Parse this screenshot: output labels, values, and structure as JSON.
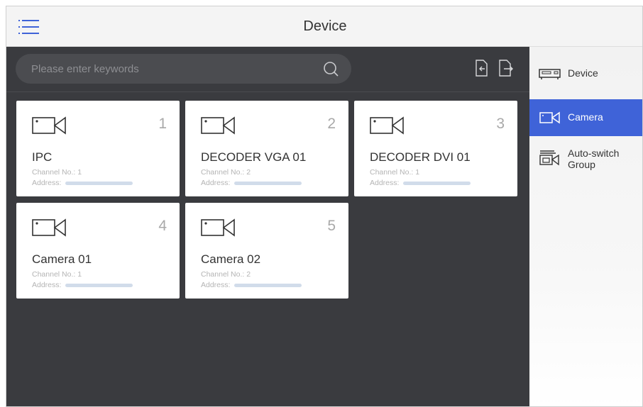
{
  "header": {
    "title": "Device"
  },
  "search": {
    "placeholder": "Please enter keywords"
  },
  "cards": [
    {
      "number": "1",
      "name": "IPC",
      "channel_label": "Channel No.:",
      "channel": "1",
      "address_label": "Address:"
    },
    {
      "number": "2",
      "name": "DECODER VGA 01",
      "channel_label": "Channel No.:",
      "channel": "2",
      "address_label": "Address:"
    },
    {
      "number": "3",
      "name": "DECODER DVI 01",
      "channel_label": "Channel No.:",
      "channel": "1",
      "address_label": "Address:"
    },
    {
      "number": "4",
      "name": "Camera 01",
      "channel_label": "Channel No.:",
      "channel": "1",
      "address_label": "Address:"
    },
    {
      "number": "5",
      "name": "Camera 02",
      "channel_label": "Channel No.:",
      "channel": "2",
      "address_label": "Address:"
    }
  ],
  "sidebar": {
    "items": [
      {
        "label": "Device",
        "icon": "device-icon",
        "active": false
      },
      {
        "label": "Camera",
        "icon": "camera-icon",
        "active": true
      },
      {
        "label": "Auto-switch\nGroup",
        "icon": "auto-switch-group-icon",
        "active": false
      }
    ]
  },
  "colors": {
    "accent": "#3f63d8",
    "panel_bg": "#3a3b3f",
    "card_bg": "#ffffff"
  }
}
